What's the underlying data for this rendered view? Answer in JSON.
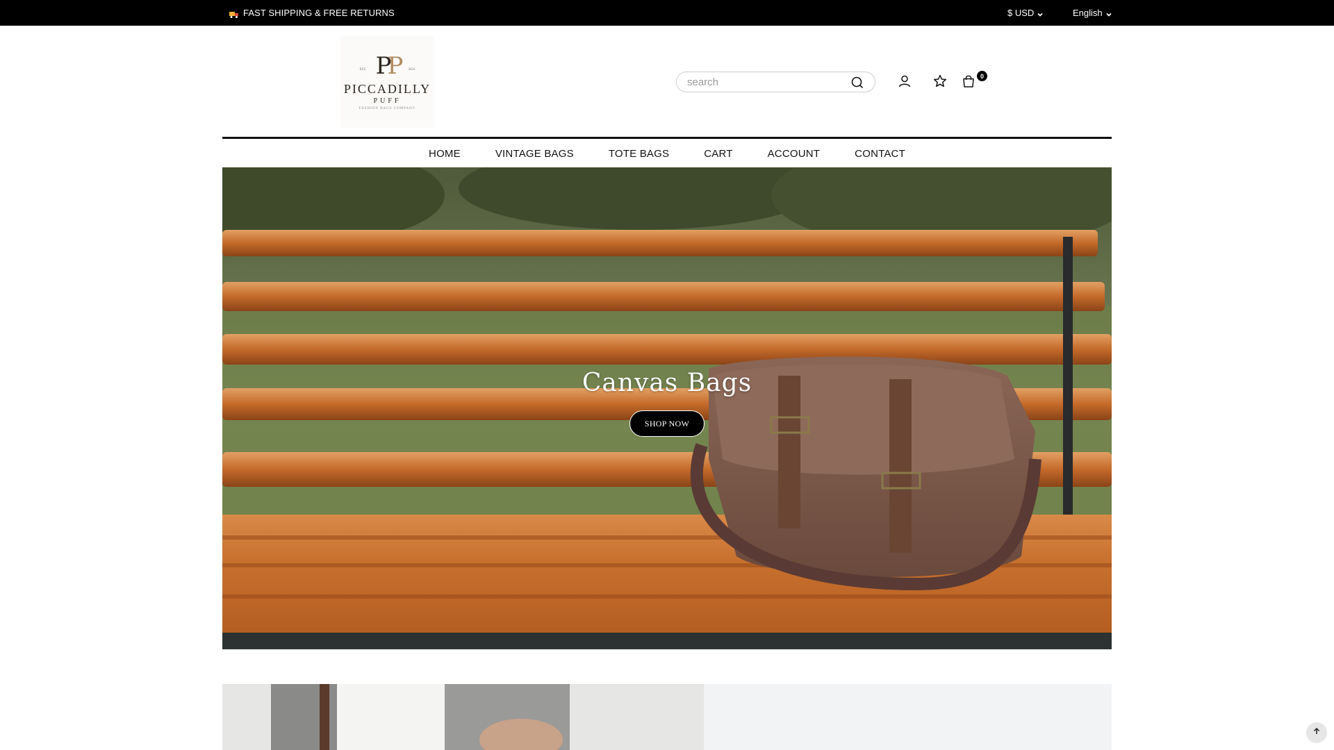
{
  "announcement": {
    "text": "FAST SHIPPING & FREE RETURNS",
    "icon": "truck-icon"
  },
  "currency": {
    "selected": "$ USD"
  },
  "language": {
    "selected": "English"
  },
  "logo": {
    "monogram_left": "P",
    "monogram_right": "P",
    "est_left": "EST.",
    "est_right": "2024",
    "brand": "PICCADILLY",
    "sub": "PUFF",
    "tagline": "FASHION BAGS COMPANY"
  },
  "search": {
    "placeholder": "search",
    "value": ""
  },
  "header_icons": {
    "account": "user-icon",
    "wishlist": "star-icon",
    "cart": "shopping-bag-icon",
    "cart_count": "0"
  },
  "nav": {
    "items": [
      {
        "label": "HOME"
      },
      {
        "label": "VINTAGE BAGS"
      },
      {
        "label": "TOTE BAGS"
      },
      {
        "label": "CART"
      },
      {
        "label": "ACCOUNT"
      },
      {
        "label": "CONTACT"
      }
    ]
  },
  "hero": {
    "title": "Canvas Bags",
    "button": "SHOP NOW"
  },
  "colors": {
    "topbar": "#000000",
    "accent_gold": "#b08a5e",
    "bench_wood": "#c8702e",
    "bag_brown": "#7a5748"
  }
}
